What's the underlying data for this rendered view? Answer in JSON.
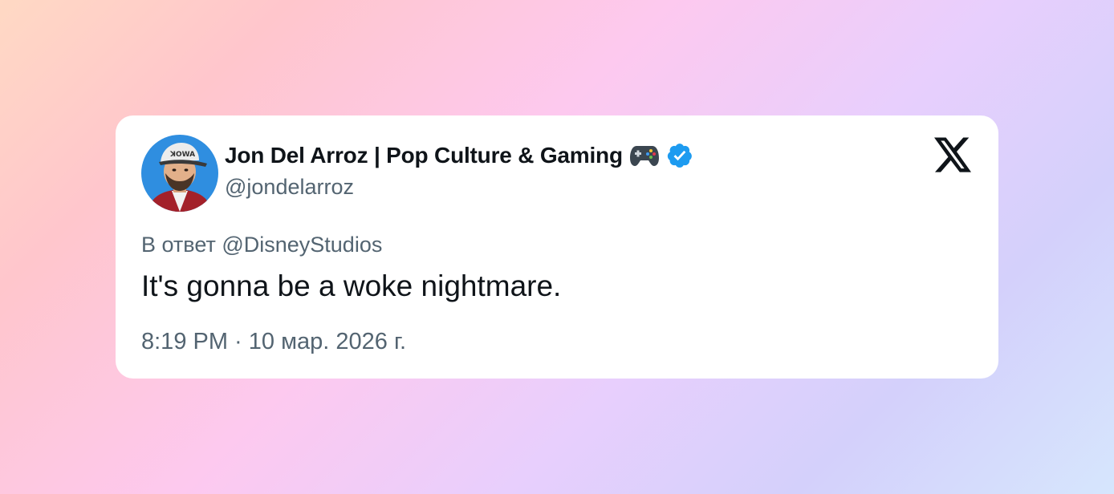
{
  "tweet": {
    "author": {
      "display_name": "Jon Del Arroz | Pop Culture & Gaming",
      "name_emoji": "video-game-controller-emoji",
      "verified": true,
      "handle": "@jondelarroz",
      "avatar": "profile-photo-man-in-cap"
    },
    "reply": {
      "prefix": "В ответ",
      "mention": "@DisneyStudios"
    },
    "text": "It's gonna be a woke nightmare.",
    "timestamp": "8:19 PM · 10 мар. 2026 г."
  },
  "icons": {
    "platform": "x-logo-icon",
    "verified": "verified-badge-icon"
  },
  "colors": {
    "verified_blue": "#1d9bf0",
    "text_primary": "#0f1419",
    "text_secondary": "#536471",
    "avatar_background": "#2f8ee0"
  }
}
